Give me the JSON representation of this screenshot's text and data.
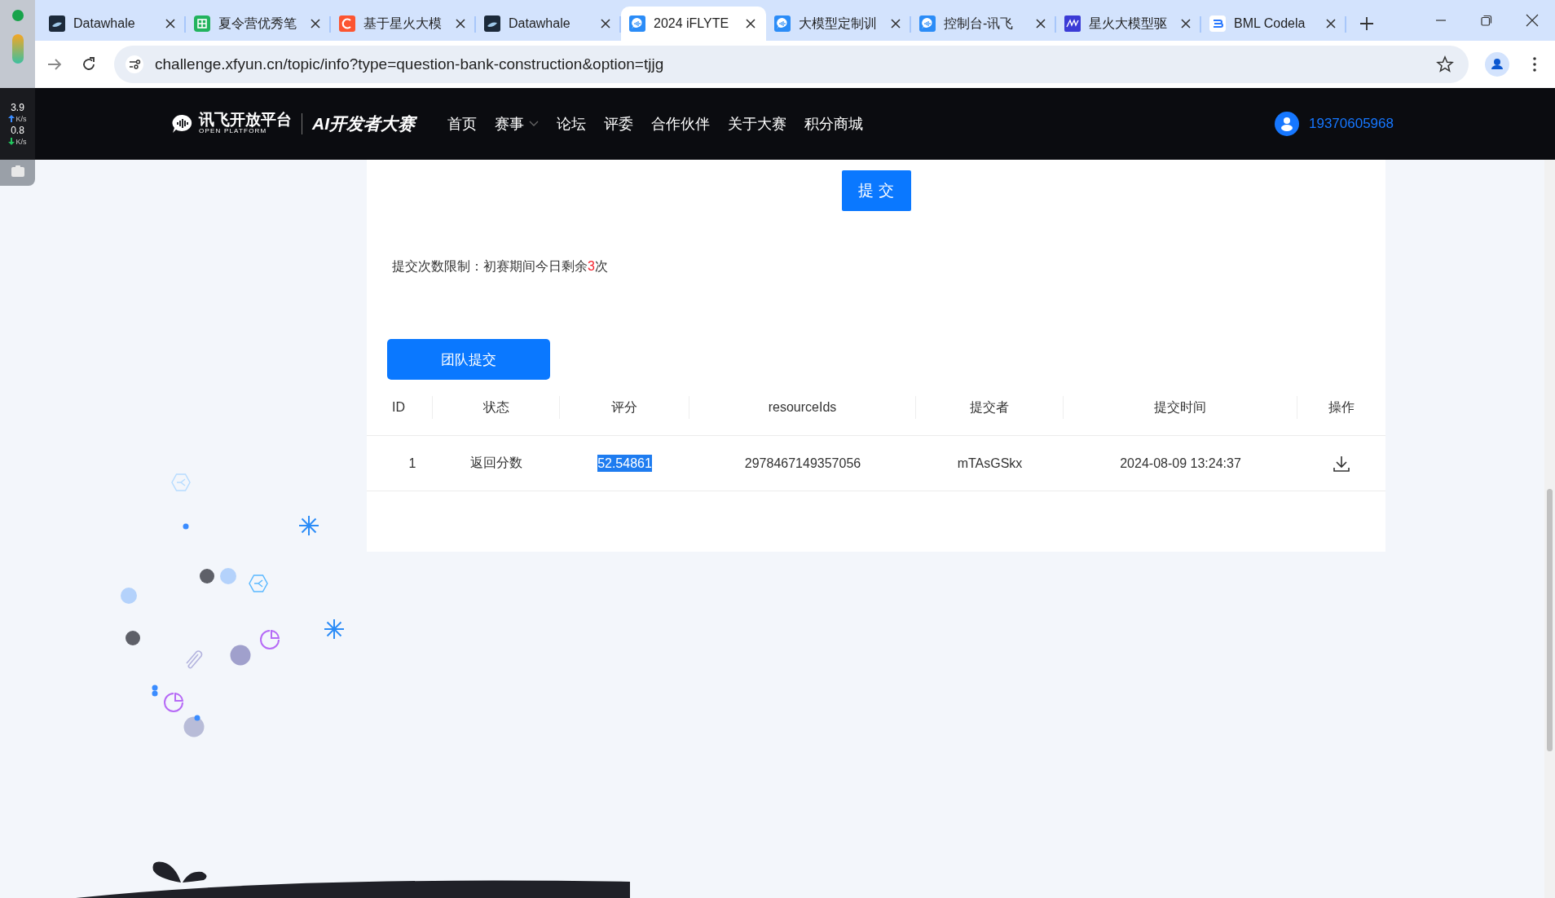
{
  "browser": {
    "tabs": [
      {
        "title": "Datawhale",
        "kind": "whale",
        "selected": false
      },
      {
        "title": "夏令营优秀笔",
        "kind": "grid",
        "selected": false
      },
      {
        "title": "基于星火大模",
        "kind": "arc",
        "selected": false
      },
      {
        "title": "Datawhale",
        "kind": "whale",
        "selected": false
      },
      {
        "title": "2024 iFLYTE",
        "kind": "bubble",
        "selected": true
      },
      {
        "title": "大模型定制训",
        "kind": "bubble",
        "selected": false
      },
      {
        "title": "控制台-讯飞",
        "kind": "bubble",
        "selected": false
      },
      {
        "title": "星火大模型驱",
        "kind": "squiggle",
        "selected": false
      },
      {
        "title": "BML Codela",
        "kind": "stack",
        "selected": false
      }
    ],
    "address": "challenge.xfyun.cn/topic/info?type=question-bank-construction&option=tjjg"
  },
  "speed_widget": {
    "upload": "3.9",
    "upload_unit": "K/s",
    "download": "0.8",
    "download_unit": "K/s"
  },
  "header": {
    "logo_name": "讯飞开放平台",
    "logo_sub": "OPEN PLATFORM",
    "contest_logo": "AI开发者大赛",
    "nav": [
      {
        "label": "首页",
        "dropdown": false
      },
      {
        "label": "赛事",
        "dropdown": true
      },
      {
        "label": "论坛",
        "dropdown": false
      },
      {
        "label": "评委",
        "dropdown": false
      },
      {
        "label": "合作伙伴",
        "dropdown": false
      },
      {
        "label": "关于大赛",
        "dropdown": false
      },
      {
        "label": "积分商城",
        "dropdown": false
      }
    ],
    "user": "19370605968"
  },
  "submit_button": "提 交",
  "limit_note": {
    "prefix": "提交次数限制：初赛期间今日剩余",
    "count": "3",
    "suffix": "次"
  },
  "team_submit_button": "团队提交",
  "table": {
    "columns": [
      "ID",
      "状态",
      "评分",
      "resourceIds",
      "提交者",
      "提交时间",
      "操作"
    ],
    "rows": [
      {
        "cells": [
          {
            "text": "1",
            "highlighted": false
          },
          {
            "text": "返回分数",
            "highlighted": false
          },
          {
            "text": "52.54861",
            "highlighted": true
          },
          {
            "text": "2978467149357056",
            "highlighted": false
          },
          {
            "text": "mTAsGSkx",
            "highlighted": false
          },
          {
            "text": "2024-08-09 13:24:37",
            "highlighted": false
          }
        ]
      }
    ]
  }
}
